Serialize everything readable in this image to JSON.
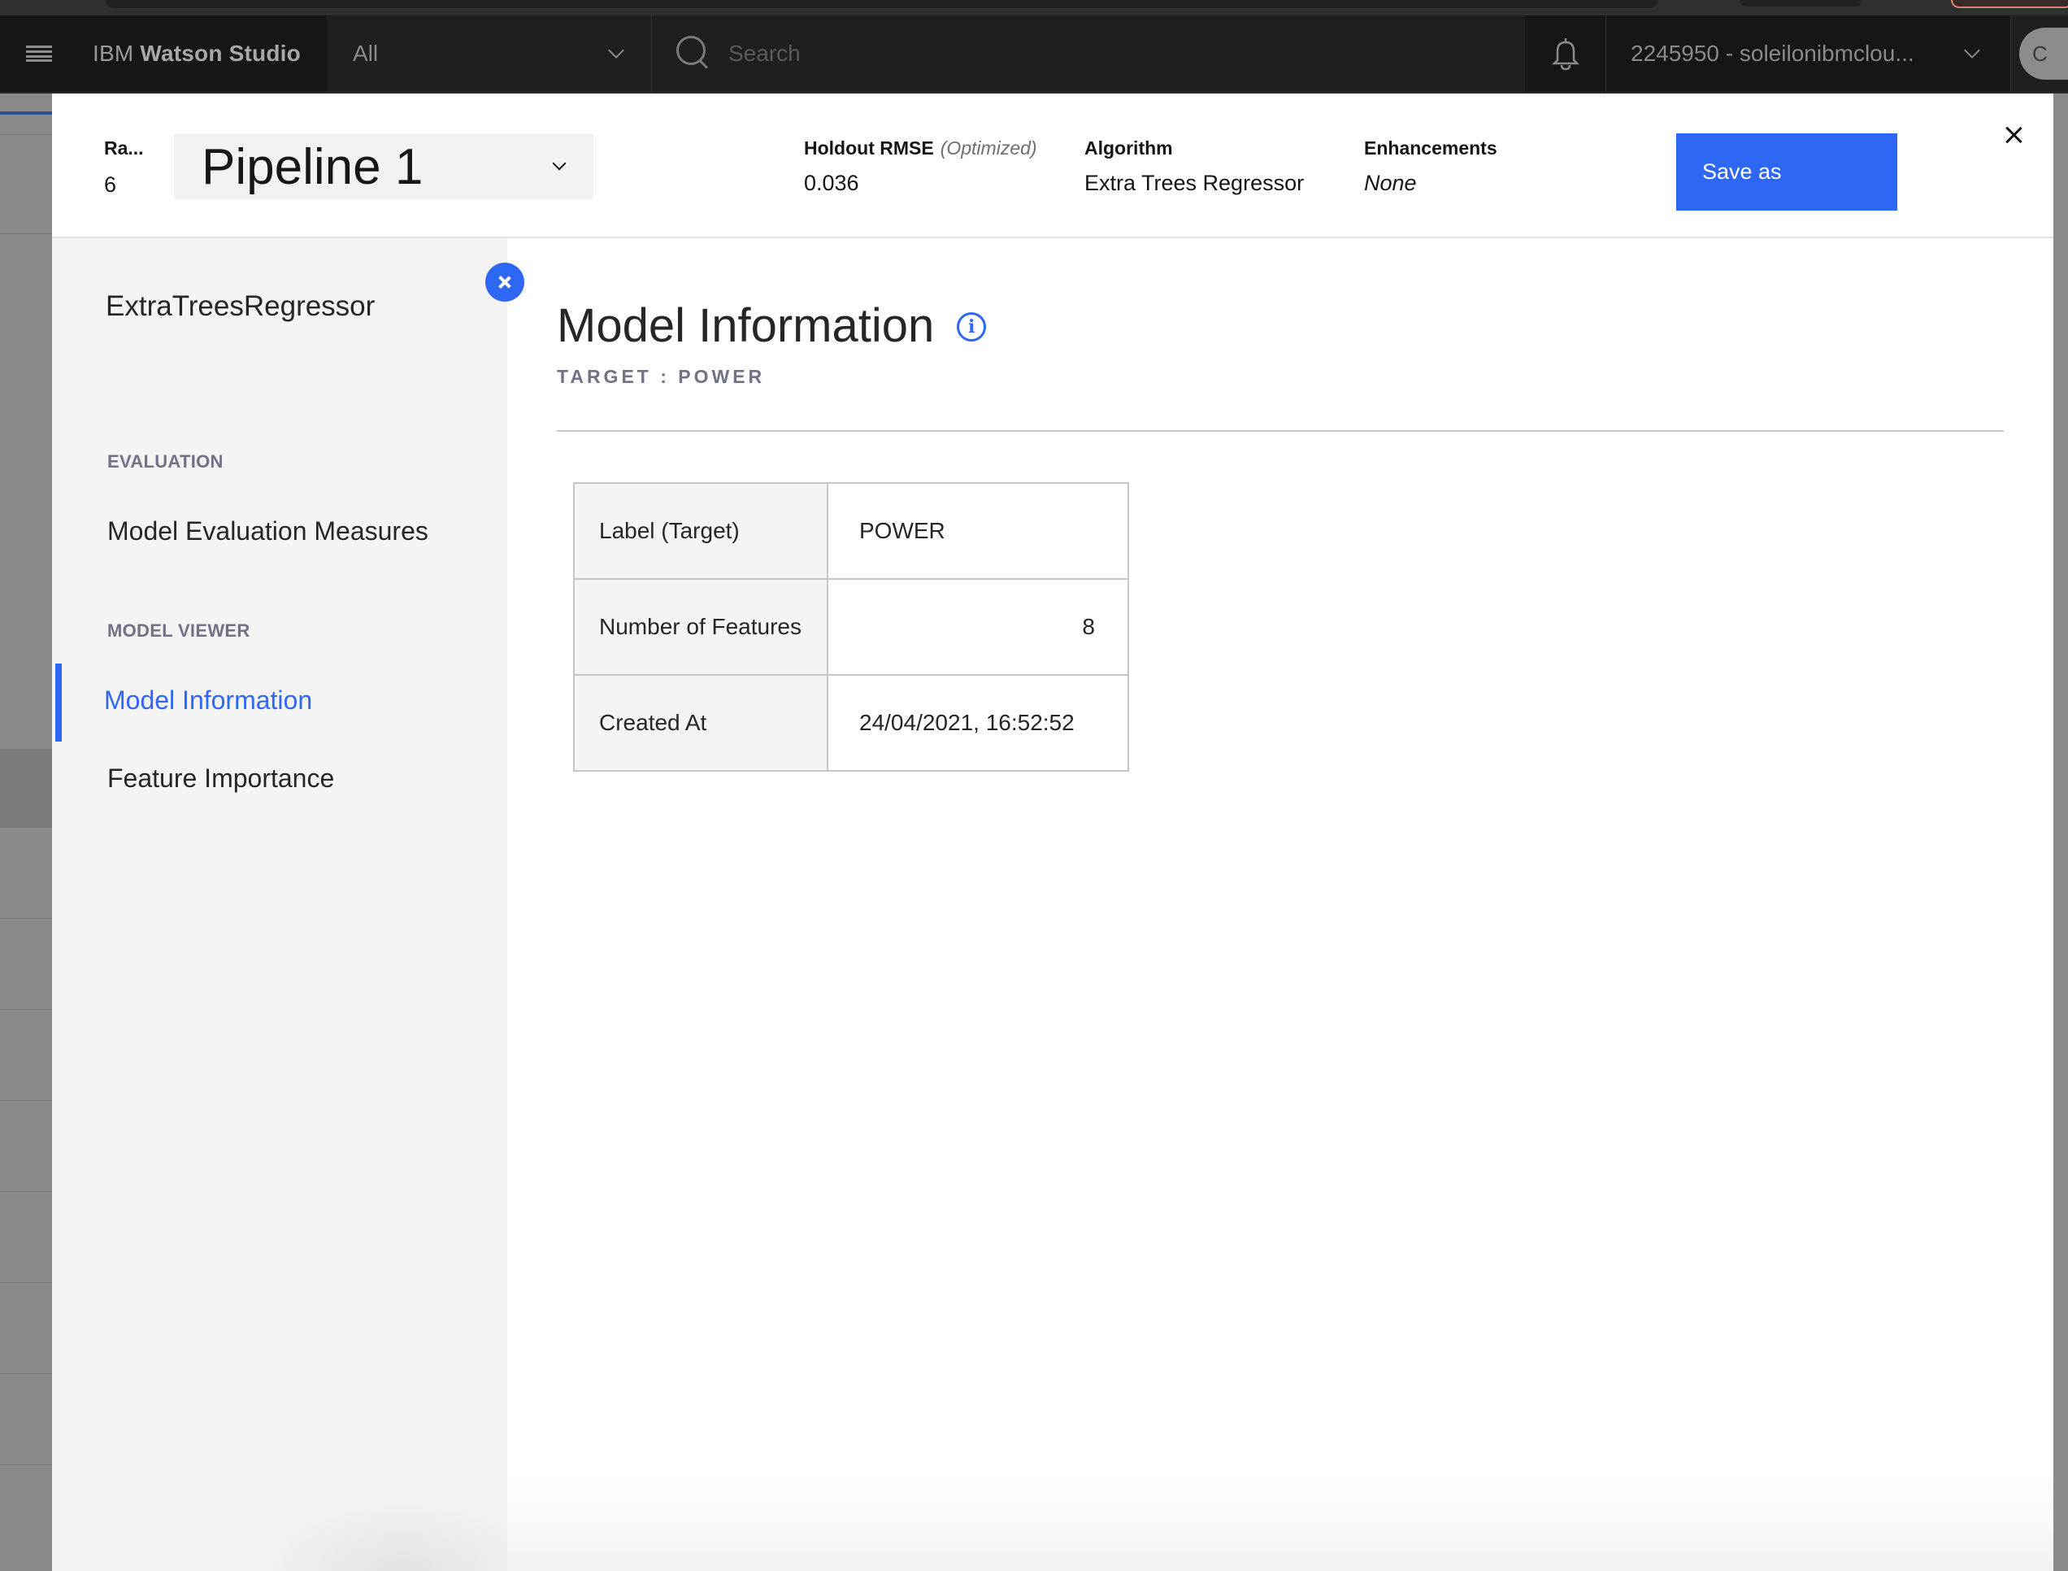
{
  "topnav": {
    "brand_prefix": "IBM",
    "brand_name": "Watson Studio",
    "scope": "All",
    "search_placeholder": "Search",
    "account": "2245950 - soleilonibmclou...",
    "avatar_initial": "C"
  },
  "header": {
    "rank_label": "Ra...",
    "rank_value": "6",
    "pipeline": "Pipeline 1",
    "metrics": [
      {
        "label": "Holdout RMSE",
        "qualifier": "(Optimized)",
        "value": "0.036"
      },
      {
        "label": "Algorithm",
        "value": "Extra Trees Regressor"
      },
      {
        "label": "Enhancements",
        "value": "None"
      }
    ],
    "save_label": "Save as"
  },
  "sidebar": {
    "model_name": "ExtraTreesRegressor",
    "sections": [
      {
        "label": "EVALUATION",
        "items": [
          {
            "label": "Model Evaluation Measures",
            "active": false
          }
        ]
      },
      {
        "label": "MODEL VIEWER",
        "items": [
          {
            "label": "Model Information",
            "active": true
          },
          {
            "label": "Feature Importance",
            "active": false
          }
        ]
      }
    ]
  },
  "content": {
    "title": "Model Information",
    "info_glyph": "i",
    "target": "TARGET : POWER",
    "table": [
      {
        "key": "Label (Target)",
        "value": "POWER"
      },
      {
        "key": "Number of Features",
        "value": "8"
      },
      {
        "key": "Created At",
        "value": "24/04/2021, 16:52:52"
      }
    ]
  },
  "colors": {
    "accent": "#2f67f5",
    "nav_bg": "#1f1f1f",
    "sidebar_bg": "#f4f4f4",
    "section_label": "#6f7385"
  }
}
